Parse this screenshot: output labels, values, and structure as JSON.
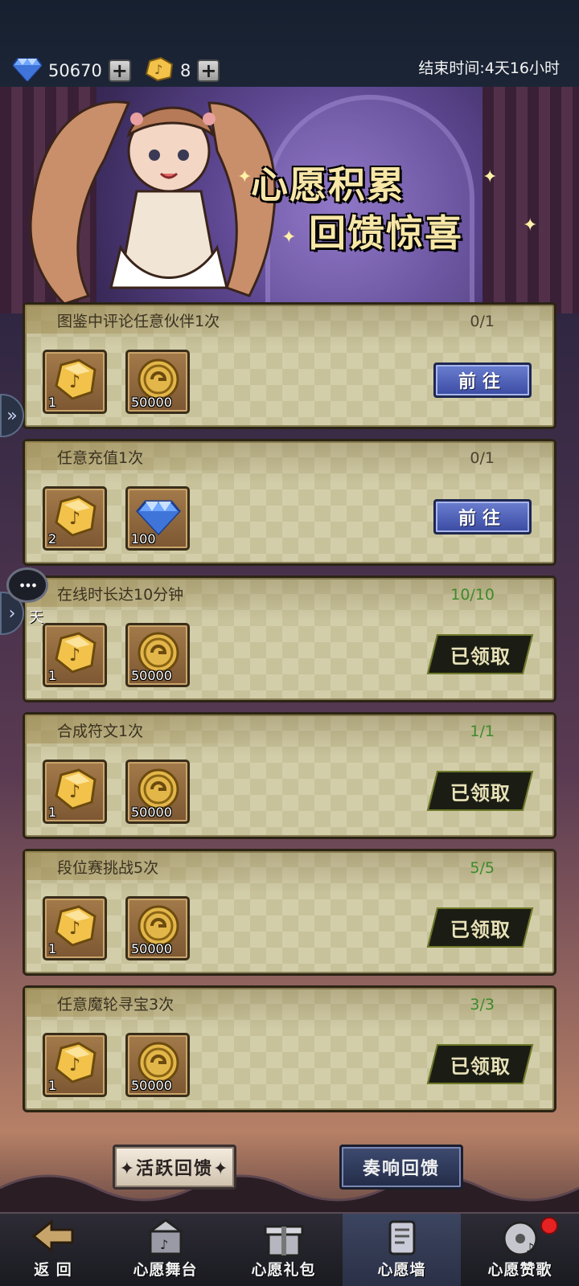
{
  "currency": {
    "gems": "50670",
    "tokens": "8",
    "plus_symbol": "+"
  },
  "end_time": "结束时间:4天16小时",
  "banner": {
    "title_line1": "心愿积累",
    "title_line2": "回馈惊喜"
  },
  "tasks": [
    {
      "title": "图鉴中评论任意伙伴1次",
      "progress": "0/1",
      "completed": false,
      "rewards": [
        {
          "icon": "music-token-icon",
          "qty": "1"
        },
        {
          "icon": "gold-coin-icon",
          "qty": "50000"
        }
      ],
      "action": "前往"
    },
    {
      "title": "任意充值1次",
      "progress": "0/1",
      "completed": false,
      "rewards": [
        {
          "icon": "music-token-icon",
          "qty": "2"
        },
        {
          "icon": "diamond-icon",
          "qty": "100"
        }
      ],
      "action": "前往"
    },
    {
      "title": "在线时长达10分钟",
      "progress": "10/10",
      "completed": true,
      "rewards": [
        {
          "icon": "music-token-icon",
          "qty": "1"
        },
        {
          "icon": "gold-coin-icon",
          "qty": "50000"
        }
      ],
      "action": "已领取"
    },
    {
      "title": "合成符文1次",
      "progress": "1/1",
      "completed": true,
      "rewards": [
        {
          "icon": "music-token-icon",
          "qty": "1"
        },
        {
          "icon": "gold-coin-icon",
          "qty": "50000"
        }
      ],
      "action": "已领取"
    },
    {
      "title": "段位赛挑战5次",
      "progress": "5/5",
      "completed": true,
      "rewards": [
        {
          "icon": "music-token-icon",
          "qty": "1"
        },
        {
          "icon": "gold-coin-icon",
          "qty": "50000"
        }
      ],
      "action": "已领取"
    },
    {
      "title": "任意魔轮寻宝3次",
      "progress": "3/3",
      "completed": true,
      "rewards": [
        {
          "icon": "music-token-icon",
          "qty": "1"
        },
        {
          "icon": "gold-coin-icon",
          "qty": "50000"
        }
      ],
      "action": "已领取"
    }
  ],
  "side": {
    "chat_label": "天",
    "chat_bubble": "•••"
  },
  "actions": {
    "active_feedback": "✦活跃回馈✦",
    "play_feedback": "奏响回馈"
  },
  "nav": {
    "back": "返 回",
    "items": [
      "心愿舞台",
      "心愿礼包",
      "心愿墙",
      "心愿赞歌"
    ],
    "active_index": 2
  },
  "colors": {
    "progress_done": "#3e8a2a",
    "go_button": "#3a4aa2",
    "claimed_bg": "#1b1d14"
  }
}
